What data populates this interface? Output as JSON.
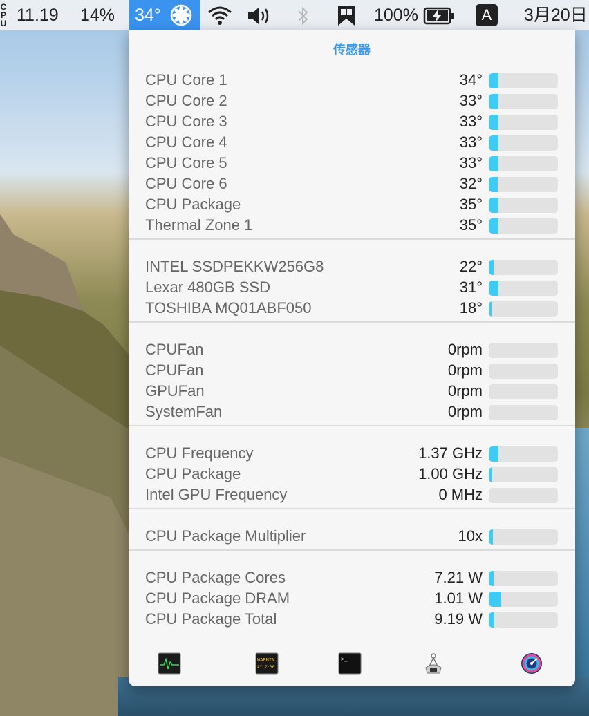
{
  "menubar": {
    "cpu_tag": "CPU",
    "cpu_load": "11.19",
    "cpu_percent": "14%",
    "temp": "34°",
    "battery": "100%",
    "input_source": "A",
    "date": "3月20日"
  },
  "popup": {
    "title": "传感器",
    "sections": [
      {
        "rows": [
          {
            "label": "CPU Core 1",
            "value": "34°",
            "level": 0.14
          },
          {
            "label": "CPU Core 2",
            "value": "33°",
            "level": 0.14
          },
          {
            "label": "CPU Core 3",
            "value": "33°",
            "level": 0.14
          },
          {
            "label": "CPU Core 4",
            "value": "33°",
            "level": 0.14
          },
          {
            "label": "CPU Core 5",
            "value": "33°",
            "level": 0.14
          },
          {
            "label": "CPU Core 6",
            "value": "32°",
            "level": 0.13
          },
          {
            "label": "CPU Package",
            "value": "35°",
            "level": 0.14
          },
          {
            "label": "Thermal Zone 1",
            "value": "35°",
            "level": 0.14
          }
        ]
      },
      {
        "rows": [
          {
            "label": "INTEL SSDPEKKW256G8",
            "value": "22°",
            "level": 0.07
          },
          {
            "label": "Lexar 480GB SSD",
            "value": "31°",
            "level": 0.14
          },
          {
            "label": "TOSHIBA MQ01ABF050",
            "value": "18°",
            "level": 0.04
          }
        ]
      },
      {
        "rows": [
          {
            "label": "CPUFan",
            "value": "0rpm",
            "level": 0
          },
          {
            "label": "CPUFan",
            "value": "0rpm",
            "level": 0
          },
          {
            "label": "GPUFan",
            "value": "0rpm",
            "level": 0
          },
          {
            "label": "SystemFan",
            "value": "0rpm",
            "level": 0
          }
        ]
      },
      {
        "rows": [
          {
            "label": "CPU Frequency",
            "value": "1.37 GHz",
            "level": 0.14
          },
          {
            "label": "CPU Package",
            "value": "1.00 GHz",
            "level": 0.05
          },
          {
            "label": "Intel GPU Frequency",
            "value": "0 MHz",
            "level": 0
          }
        ]
      },
      {
        "rows": [
          {
            "label": "CPU Package Multiplier",
            "value": "10x",
            "level": 0.06
          }
        ]
      },
      {
        "rows": [
          {
            "label": "CPU Package Cores",
            "value": "7.21 W",
            "level": 0.07
          },
          {
            "label": "CPU Package DRAM",
            "value": "1.01 W",
            "level": 0.17
          },
          {
            "label": "CPU Package Total",
            "value": "9.19 W",
            "level": 0.08
          }
        ]
      }
    ],
    "toolbar": [
      {
        "icon": "activity-monitor-icon"
      },
      {
        "icon": "console-icon",
        "label": "WARNIN"
      },
      {
        "icon": "terminal-icon",
        "label": ">_"
      },
      {
        "icon": "system-information-icon"
      },
      {
        "icon": "disk-utility-icon"
      }
    ]
  },
  "colors": {
    "accent": "#3a9bea",
    "bar_fill": "#3ecbf6",
    "bar_track": "#e2e2e2",
    "menubar_highlight": "#3b93f0"
  }
}
